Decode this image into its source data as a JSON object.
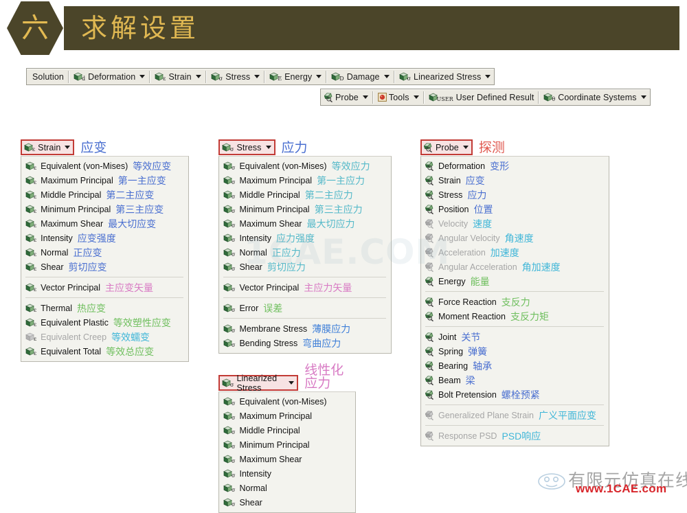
{
  "header": {
    "badge": "六",
    "title": "求解设置"
  },
  "toolbar_top": {
    "solution_label": "Solution",
    "items": [
      {
        "label": "Deformation",
        "icon": "cube-icon",
        "sub": "d",
        "caret": true
      },
      {
        "label": "Strain",
        "icon": "cube-icon",
        "sub": "ε",
        "caret": true
      },
      {
        "label": "Stress",
        "icon": "cube-icon",
        "sub": "σ",
        "caret": true
      },
      {
        "label": "Energy",
        "icon": "cube-icon",
        "sub": "E",
        "caret": true
      },
      {
        "label": "Damage",
        "icon": "cube-icon",
        "sub": "D",
        "caret": true
      },
      {
        "label": "Linearized Stress",
        "icon": "cube-icon",
        "sub": "σ",
        "caret": true
      }
    ]
  },
  "toolbar_bottom": {
    "items": [
      {
        "label": "Probe",
        "icon": "probe-icon",
        "sub": "",
        "caret": true
      },
      {
        "label": "Tools",
        "icon": "tools-icon",
        "sub": "",
        "caret": true
      },
      {
        "label": "User Defined Result",
        "icon": "cube-icon",
        "sub": "USER",
        "caret": false
      },
      {
        "label": "Coordinate Systems",
        "icon": "cube-icon",
        "sub": "θ",
        "caret": true
      }
    ]
  },
  "menus": {
    "strain": {
      "button_label": "Strain",
      "button_sub": "ε",
      "button_icon": "cube-icon",
      "title_cn": "应变",
      "title_cn_color": "#4a6fd0",
      "groups": [
        {
          "items": [
            {
              "en": "Equivalent (von-Mises)",
              "cn": "等效应变",
              "color": "c-blue",
              "disabled": false
            },
            {
              "en": "Maximum Principal",
              "cn": "第一主应变",
              "color": "c-blue",
              "disabled": false
            },
            {
              "en": "Middle Principal",
              "cn": "第二主应变",
              "color": "c-blue",
              "disabled": false
            },
            {
              "en": "Minimum Principal",
              "cn": "第三主应变",
              "color": "c-blue",
              "disabled": false
            },
            {
              "en": "Maximum Shear",
              "cn": "最大切应变",
              "color": "c-blue",
              "disabled": false
            },
            {
              "en": "Intensity",
              "cn": "应变强度",
              "color": "c-blue",
              "disabled": false
            },
            {
              "en": "Normal",
              "cn": "正应变",
              "color": "c-blue",
              "disabled": false
            },
            {
              "en": "Shear",
              "cn": "剪切应变",
              "color": "c-blue",
              "disabled": false
            }
          ]
        },
        {
          "items": [
            {
              "en": "Vector Principal",
              "cn": "主应变矢量",
              "color": "c-pink",
              "disabled": false
            }
          ]
        },
        {
          "items": [
            {
              "en": "Thermal",
              "cn": "热应变",
              "color": "c-green",
              "disabled": false
            },
            {
              "en": "Equivalent Plastic",
              "cn": "等效塑性应变",
              "color": "c-green",
              "disabled": false
            },
            {
              "en": "Equivalent Creep",
              "cn": "等效蠕变",
              "color": "c-cyan",
              "disabled": true
            },
            {
              "en": "Equivalent Total",
              "cn": "等效总应变",
              "color": "c-green",
              "disabled": false
            }
          ]
        }
      ]
    },
    "stress": {
      "button_label": "Stress",
      "button_sub": "σ",
      "button_icon": "cube-icon",
      "title_cn": "应力",
      "title_cn_color": "#4a6fd0",
      "groups": [
        {
          "items": [
            {
              "en": "Equivalent (von-Mises)",
              "cn": "等效应力",
              "color": "c-teal",
              "disabled": false
            },
            {
              "en": "Maximum Principal",
              "cn": "第一主应力",
              "color": "c-teal",
              "disabled": false
            },
            {
              "en": "Middle Principal",
              "cn": "第二主应力",
              "color": "c-teal",
              "disabled": false
            },
            {
              "en": "Minimum Principal",
              "cn": "第三主应力",
              "color": "c-teal",
              "disabled": false
            },
            {
              "en": "Maximum Shear",
              "cn": "最大切应力",
              "color": "c-teal",
              "disabled": false
            },
            {
              "en": "Intensity",
              "cn": "应力强度",
              "color": "c-teal",
              "disabled": false
            },
            {
              "en": "Normal",
              "cn": "正应力",
              "color": "c-teal",
              "disabled": false
            },
            {
              "en": "Shear",
              "cn": "剪切应力",
              "color": "c-teal",
              "disabled": false
            }
          ]
        },
        {
          "items": [
            {
              "en": "Vector Principal",
              "cn": "主应力矢量",
              "color": "c-pink",
              "disabled": false
            }
          ]
        },
        {
          "items": [
            {
              "en": "Error",
              "cn": "误差",
              "color": "c-green",
              "disabled": false
            }
          ]
        },
        {
          "items": [
            {
              "en": "Membrane Stress",
              "cn": "薄膜应力",
              "color": "c-blue2",
              "disabled": false
            },
            {
              "en": "Bending Stress",
              "cn": "弯曲应力",
              "color": "c-blue2",
              "disabled": false
            }
          ]
        }
      ]
    },
    "linearized_stress": {
      "button_label": "Linearized Stress",
      "button_sub": "σ",
      "button_icon": "cube-icon",
      "title_cn": "线性化应力",
      "title_cn_color": "#d87bc4",
      "groups": [
        {
          "items": [
            {
              "en": "Equivalent (von-Mises)",
              "cn": "",
              "color": "",
              "disabled": false
            },
            {
              "en": "Maximum Principal",
              "cn": "",
              "color": "",
              "disabled": false
            },
            {
              "en": "Middle Principal",
              "cn": "",
              "color": "",
              "disabled": false
            },
            {
              "en": "Minimum Principal",
              "cn": "",
              "color": "",
              "disabled": false
            },
            {
              "en": "Maximum Shear",
              "cn": "",
              "color": "",
              "disabled": false
            },
            {
              "en": "Intensity",
              "cn": "",
              "color": "",
              "disabled": false
            },
            {
              "en": "Normal",
              "cn": "",
              "color": "",
              "disabled": false
            },
            {
              "en": "Shear",
              "cn": "",
              "color": "",
              "disabled": false
            }
          ]
        }
      ]
    },
    "probe": {
      "button_label": "Probe",
      "button_sub": "",
      "button_icon": "probe-icon",
      "title_cn": "探测",
      "title_cn_color": "#e0584f",
      "groups": [
        {
          "items": [
            {
              "en": "Deformation",
              "cn": "变形",
              "color": "c-blue",
              "disabled": false
            },
            {
              "en": "Strain",
              "cn": "应变",
              "color": "c-blue",
              "disabled": false
            },
            {
              "en": "Stress",
              "cn": "应力",
              "color": "c-blue",
              "disabled": false
            },
            {
              "en": "Position",
              "cn": "位置",
              "color": "c-blue",
              "disabled": false
            },
            {
              "en": "Velocity",
              "cn": "速度",
              "color": "c-cyan",
              "disabled": true
            },
            {
              "en": "Angular Velocity",
              "cn": "角速度",
              "color": "c-cyan",
              "disabled": true
            },
            {
              "en": "Acceleration",
              "cn": "加速度",
              "color": "c-cyan",
              "disabled": true
            },
            {
              "en": "Angular Acceleration",
              "cn": "角加速度",
              "color": "c-cyan",
              "disabled": true
            },
            {
              "en": "Energy",
              "cn": "能量",
              "color": "c-green",
              "disabled": false
            }
          ]
        },
        {
          "items": [
            {
              "en": "Force Reaction",
              "cn": "支反力",
              "color": "c-green",
              "disabled": false
            },
            {
              "en": "Moment Reaction",
              "cn": "支反力矩",
              "color": "c-green",
              "disabled": false
            }
          ]
        },
        {
          "items": [
            {
              "en": "Joint",
              "cn": "关节",
              "color": "c-blue",
              "disabled": false
            },
            {
              "en": "Spring",
              "cn": "弹簧",
              "color": "c-blue",
              "disabled": false
            },
            {
              "en": "Bearing",
              "cn": "轴承",
              "color": "c-blue",
              "disabled": false
            },
            {
              "en": "Beam",
              "cn": "梁",
              "color": "c-blue",
              "disabled": false
            },
            {
              "en": "Bolt Pretension",
              "cn": "螺栓预紧",
              "color": "c-blue",
              "disabled": false
            }
          ]
        },
        {
          "items": [
            {
              "en": "Generalized Plane Strain",
              "cn": "广义平面应变",
              "color": "c-cyan",
              "disabled": true
            }
          ]
        },
        {
          "items": [
            {
              "en": "Response PSD",
              "cn": "PSD响应",
              "color": "c-cyan",
              "disabled": true
            }
          ]
        }
      ]
    }
  },
  "watermarks": {
    "center": "1CAE.COM",
    "logo_cn": "有限元仿真在线",
    "logo_url": "www.1CAE.com"
  }
}
